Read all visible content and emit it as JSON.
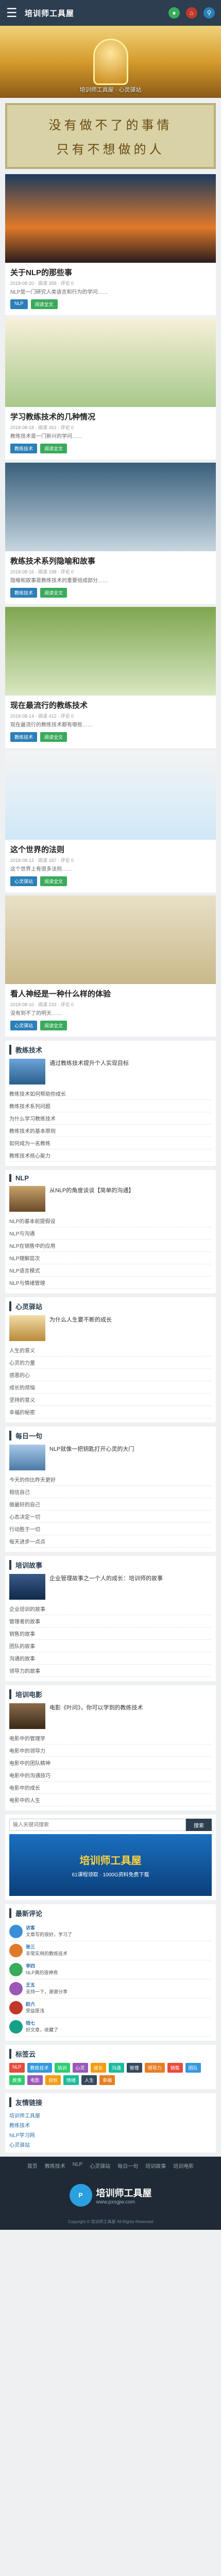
{
  "header": {
    "logo": "培训师工具屋"
  },
  "banner": {
    "caption": "培训师工具屋 · 心灵驿站"
  },
  "slogan": {
    "line1": "没有做不了的事情",
    "line2": "只有不想做的人"
  },
  "posts": [
    {
      "title": "关于NLP的那些事",
      "meta": "2018-08-20 · 阅读 358 · 评论 0",
      "excerpt": "NLP是一门研究人类语言和行为的学问……",
      "tags": [
        "NLP",
        "阅读全文"
      ]
    },
    {
      "title": "学习教练技术的几种情况",
      "meta": "2018-08-18 · 阅读 261 · 评论 0",
      "excerpt": "教练技术是一门新兴的学问……",
      "tags": [
        "教练技术",
        "阅读全文"
      ]
    },
    {
      "title": "教练技术系列隐喻和故事",
      "meta": "2018-08-16 · 阅读 198 · 评论 0",
      "excerpt": "隐喻和故事是教练技术的重要组成部分……",
      "tags": [
        "教练技术",
        "阅读全文"
      ]
    },
    {
      "title": "现在最流行的教练技术",
      "meta": "2018-08-14 · 阅读 412 · 评论 0",
      "excerpt": "现在最流行的教练技术都有哪些……",
      "tags": [
        "教练技术",
        "阅读全文"
      ]
    },
    {
      "title": "这个世界的法则",
      "meta": "2018-08-12 · 阅读 187 · 评论 0",
      "excerpt": "这个世界上有很多法则……",
      "tags": [
        "心灵驿站",
        "阅读全文"
      ]
    },
    {
      "title": "看人神经是一种什么样的体验",
      "meta": "2018-08-10 · 阅读 233 · 评论 0",
      "excerpt": "没有到不了的明天……",
      "tags": [
        "心灵驿站",
        "阅读全文"
      ]
    }
  ],
  "widgets": [
    {
      "title": "教练技术",
      "feat": "通过教练技术提升个人实现目标",
      "items": [
        "教练技术如何帮助你成长",
        "教练技术系列问题",
        "为什么学习教练技术",
        "教练技术的基本原则",
        "如何成为一名教练",
        "教练技术核心能力"
      ]
    },
    {
      "title": "NLP",
      "feat": "从NLP的角度谈谈【简单的沟通】",
      "items": [
        "NLP的基本前提假设",
        "NLP与沟通",
        "NLP在销售中的应用",
        "NLP理解层次",
        "NLP语言模式",
        "NLP与情绪管理"
      ]
    },
    {
      "title": "心灵驿站",
      "feat": "为什么人生要不断的成长",
      "items": [
        "人生的意义",
        "心灵的力量",
        "感恩的心",
        "成长的烦恼",
        "坚持的意义",
        "幸福的秘密"
      ]
    },
    {
      "title": "每日一句",
      "feat": "NLP就像一把钥匙打开心灵的大门",
      "items": [
        "今天的你比昨天更好",
        "相信自己",
        "做最好的自己",
        "心态决定一切",
        "行动胜于一切",
        "每天进步一点点"
      ]
    },
    {
      "title": "培训故事",
      "feat": "企业管理故事之一个人的成长：培训师的故事",
      "items": [
        "企业培训的故事",
        "管理者的故事",
        "销售的故事",
        "团队的故事",
        "沟通的故事",
        "领导力的故事"
      ]
    },
    {
      "title": "培训电影",
      "feat": "电影《叶问》，你可以学到的教练技术",
      "items": [
        "电影中的管理学",
        "电影中的领导力",
        "电影中的团队精神",
        "电影中的沟通技巧",
        "电影中的成长",
        "电影中的人生"
      ]
    }
  ],
  "search": {
    "placeholder": "输入关键词搜索",
    "button": "搜索"
  },
  "ad": {
    "big": "培训师工具屋",
    "small": "61课程领取 · 1000G资料免费下载"
  },
  "comments": {
    "title": "最新评论",
    "items": [
      {
        "name": "访客",
        "text": "文章写的很好，学习了"
      },
      {
        "name": "张三",
        "text": "非常实用的教练技术"
      },
      {
        "name": "李四",
        "text": "NLP真的很神奇"
      },
      {
        "name": "王五",
        "text": "支持一下，谢谢分享"
      },
      {
        "name": "赵六",
        "text": "受益匪浅"
      },
      {
        "name": "钱七",
        "text": "好文章，收藏了"
      }
    ]
  },
  "tags": {
    "title": "标签云",
    "items": [
      "NLP",
      "教练技术",
      "培训",
      "心灵",
      "成长",
      "沟通",
      "管理",
      "领导力",
      "销售",
      "团队",
      "故事",
      "电影",
      "目标",
      "情绪",
      "人生",
      "幸福"
    ]
  },
  "links": {
    "title": "友情链接",
    "items": [
      "培训师工具屋",
      "教练技术",
      "NLP学习网",
      "心灵驿站"
    ]
  },
  "footer": {
    "nav": [
      "首页",
      "教练技术",
      "NLP",
      "心灵驿站",
      "每日一句",
      "培训故事",
      "培训电影"
    ],
    "logo": "培训师工具屋",
    "url": "www.pxsgjw.com",
    "copy": "Copyright © 培训师工具屋 All Rights Reserved"
  }
}
